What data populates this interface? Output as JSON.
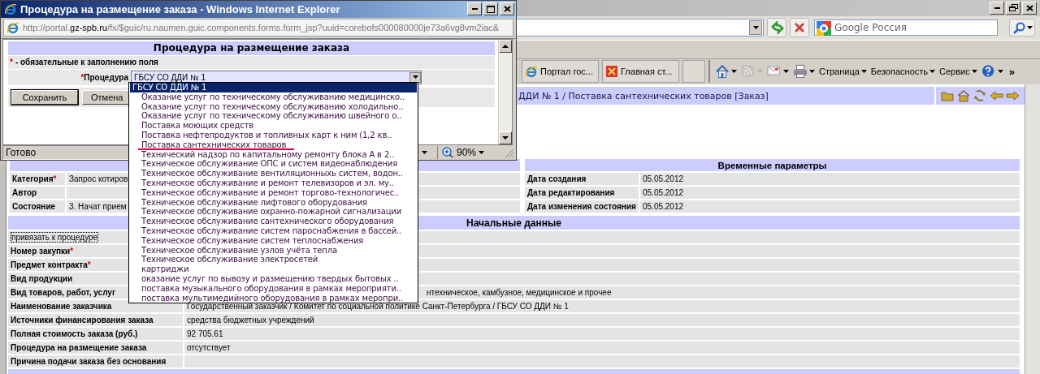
{
  "browser": {
    "search": {
      "placeholder": "Google Россия"
    },
    "tabs": [
      {
        "kind": "page",
        "label": "Портал гос...",
        "selected": false
      },
      {
        "kind": "page",
        "label": "Главная ст...",
        "selected": false
      },
      {
        "kind": "new",
        "selected": false
      }
    ],
    "commands": [
      {
        "kind": "home",
        "disabled": false
      },
      {
        "kind": "feeds",
        "disabled": true
      },
      {
        "kind": "mail",
        "disabled": false
      },
      {
        "kind": "print",
        "disabled": false
      },
      {
        "kind": "menu",
        "label": "Страница",
        "disabled": false
      },
      {
        "kind": "menu",
        "label": "Безопасность",
        "disabled": false
      },
      {
        "kind": "menu",
        "label": "Сервис",
        "disabled": false
      },
      {
        "kind": "help",
        "disabled": false
      }
    ],
    "overflow": "»"
  },
  "page": {
    "breadcrumb": "ДДИ № 1 / Поставка сантехнических товаров [Заказ]",
    "general": {
      "rows": [
        {
          "label": "Категория",
          "required": true,
          "value": "Запрос котиров"
        },
        {
          "label": "Автор",
          "required": false
        },
        {
          "label": "Состояние",
          "required": false,
          "value": "3. Начат прием"
        }
      ]
    },
    "time_params": {
      "title": "Временные параметры",
      "rows": [
        {
          "label": "Дата создания",
          "value": "05.05.2012"
        },
        {
          "label": "Дата редактирования",
          "value": "05.05.2012"
        },
        {
          "label": "Дата изменения состояния",
          "value": "05.05.2012"
        }
      ]
    },
    "initial_data": {
      "title": "Начальные данные",
      "link": "привязать к процедуре",
      "rows": [
        {
          "label": "Номер закупки",
          "required": true
        },
        {
          "label": "Предмет контракта",
          "required": true
        },
        {
          "label": "Вид продукции",
          "required": false
        },
        {
          "label": "Вид товаров, работ, услуг",
          "required": false,
          "value": "нтехническое, камбузное, медицинское и прочее",
          "partly_hidden": true
        },
        {
          "label": "Наименование заказчика",
          "required": false,
          "value": "Государственный заказчик / Комитет по социальной политике Санкт-Петербурга / ГБСУ СО ДДИ № 1"
        },
        {
          "label": "Источники финансирования заказа",
          "required": false,
          "value": "средства бюджетных учреждений"
        },
        {
          "label": "Полная стоимость заказа (руб.)",
          "required": false,
          "value": "92 705.61"
        },
        {
          "label": "Процедура на размещение заказа",
          "required": false,
          "value": "отсутствует"
        },
        {
          "label": "Причина подачи заказа без основания",
          "required": false
        }
      ]
    }
  },
  "popup": {
    "title": "Процедура на размещение заказа - Windows Internet Explorer",
    "url_parts": [
      {
        "text": "http://portal.",
        "emphasis": false
      },
      {
        "text": "gz-spb.ru",
        "emphasis": true
      },
      {
        "text": "/fx/$guic/ru.naumen.guic.components.forms.form_jsp?uuid=corebofs000080000je73a6vg8vm2iac&",
        "emphasis": false
      }
    ],
    "form": {
      "title": "Процедура на размещение заказа",
      "required_mark": "*",
      "required_note": "- обязательные к заполнению поля",
      "field": {
        "label": "Процедура",
        "required": true,
        "value": "ГБСУ СО ДДИ № 1"
      },
      "buttons": [
        {
          "label": "Сохранить",
          "default": true
        },
        {
          "label": "Отмена",
          "default": false
        }
      ]
    },
    "status_bar": {
      "text": "Готово",
      "zoom": "90%"
    }
  },
  "dropdown": {
    "options": [
      {
        "label": "ГБСУ СО ДДИ № 1",
        "selected": true,
        "highlighted": false,
        "children": [
          {
            "label": "Оказание услуг по техническому обслуживанию медицинско..",
            "selected": false,
            "highlighted": false
          },
          {
            "label": "Оказание услуг по техническому обслуживанию холодильно..",
            "selected": false,
            "highlighted": false
          },
          {
            "label": "Оказание услуг по техническому обслуживанию швейного о..",
            "selected": false,
            "highlighted": false
          },
          {
            "label": "Поставка моющих средств",
            "selected": false,
            "highlighted": false
          },
          {
            "label": "Поставка нефтепродуктов и топливных карт к ним (1,2 кв..",
            "selected": false,
            "highlighted": false
          },
          {
            "label": "Поставка сантехнических товаров",
            "selected": false,
            "highlighted": true
          },
          {
            "label": "Технический надзор по капитальному ремонту блока А в 2..",
            "selected": false,
            "highlighted": false
          },
          {
            "label": "Техническое обслуживание ОПС и систем видеонаблюдения",
            "selected": false,
            "highlighted": false
          },
          {
            "label": "Техническое обслуживание вентиляционныхь систем, водон..",
            "selected": false,
            "highlighted": false
          },
          {
            "label": "Техническое обслуживание и ремонт телевизоров и эл. му..",
            "selected": false,
            "highlighted": false
          },
          {
            "label": "Техническое обслуживание и ремонт торгово-технологичес..",
            "selected": false,
            "highlighted": false
          },
          {
            "label": "Техническое обслуживание лифтового оборудования",
            "selected": false,
            "highlighted": false
          },
          {
            "label": "Техническое обслуживание охранно-пожарной сигнализации",
            "selected": false,
            "highlighted": false
          },
          {
            "label": "Техническое обслуживание сантехнического оборудования",
            "selected": false,
            "highlighted": false
          },
          {
            "label": "Техническое обслуживание систем пароснабжения в бассей..",
            "selected": false,
            "highlighted": false
          },
          {
            "label": "Техническое обслуживание систем теплоснабжения",
            "selected": false,
            "highlighted": false
          },
          {
            "label": "Техническое обслуживание узлов учёта тепла",
            "selected": false,
            "highlighted": false
          },
          {
            "label": "Техническое обслуживание электросетей",
            "selected": false,
            "highlighted": false
          },
          {
            "label": "картриджи",
            "selected": false,
            "highlighted": false
          },
          {
            "label": "оказание услуг по вывозу и размещению твердых бытовых ..",
            "selected": false,
            "highlighted": false
          },
          {
            "label": "поставка музыкального оборудования в рамках мероприяти..",
            "selected": false,
            "highlighted": false
          },
          {
            "label": "поставка мультимедийного оборудования в рамках меропри..",
            "selected": false,
            "highlighted": false
          }
        ]
      }
    ]
  }
}
